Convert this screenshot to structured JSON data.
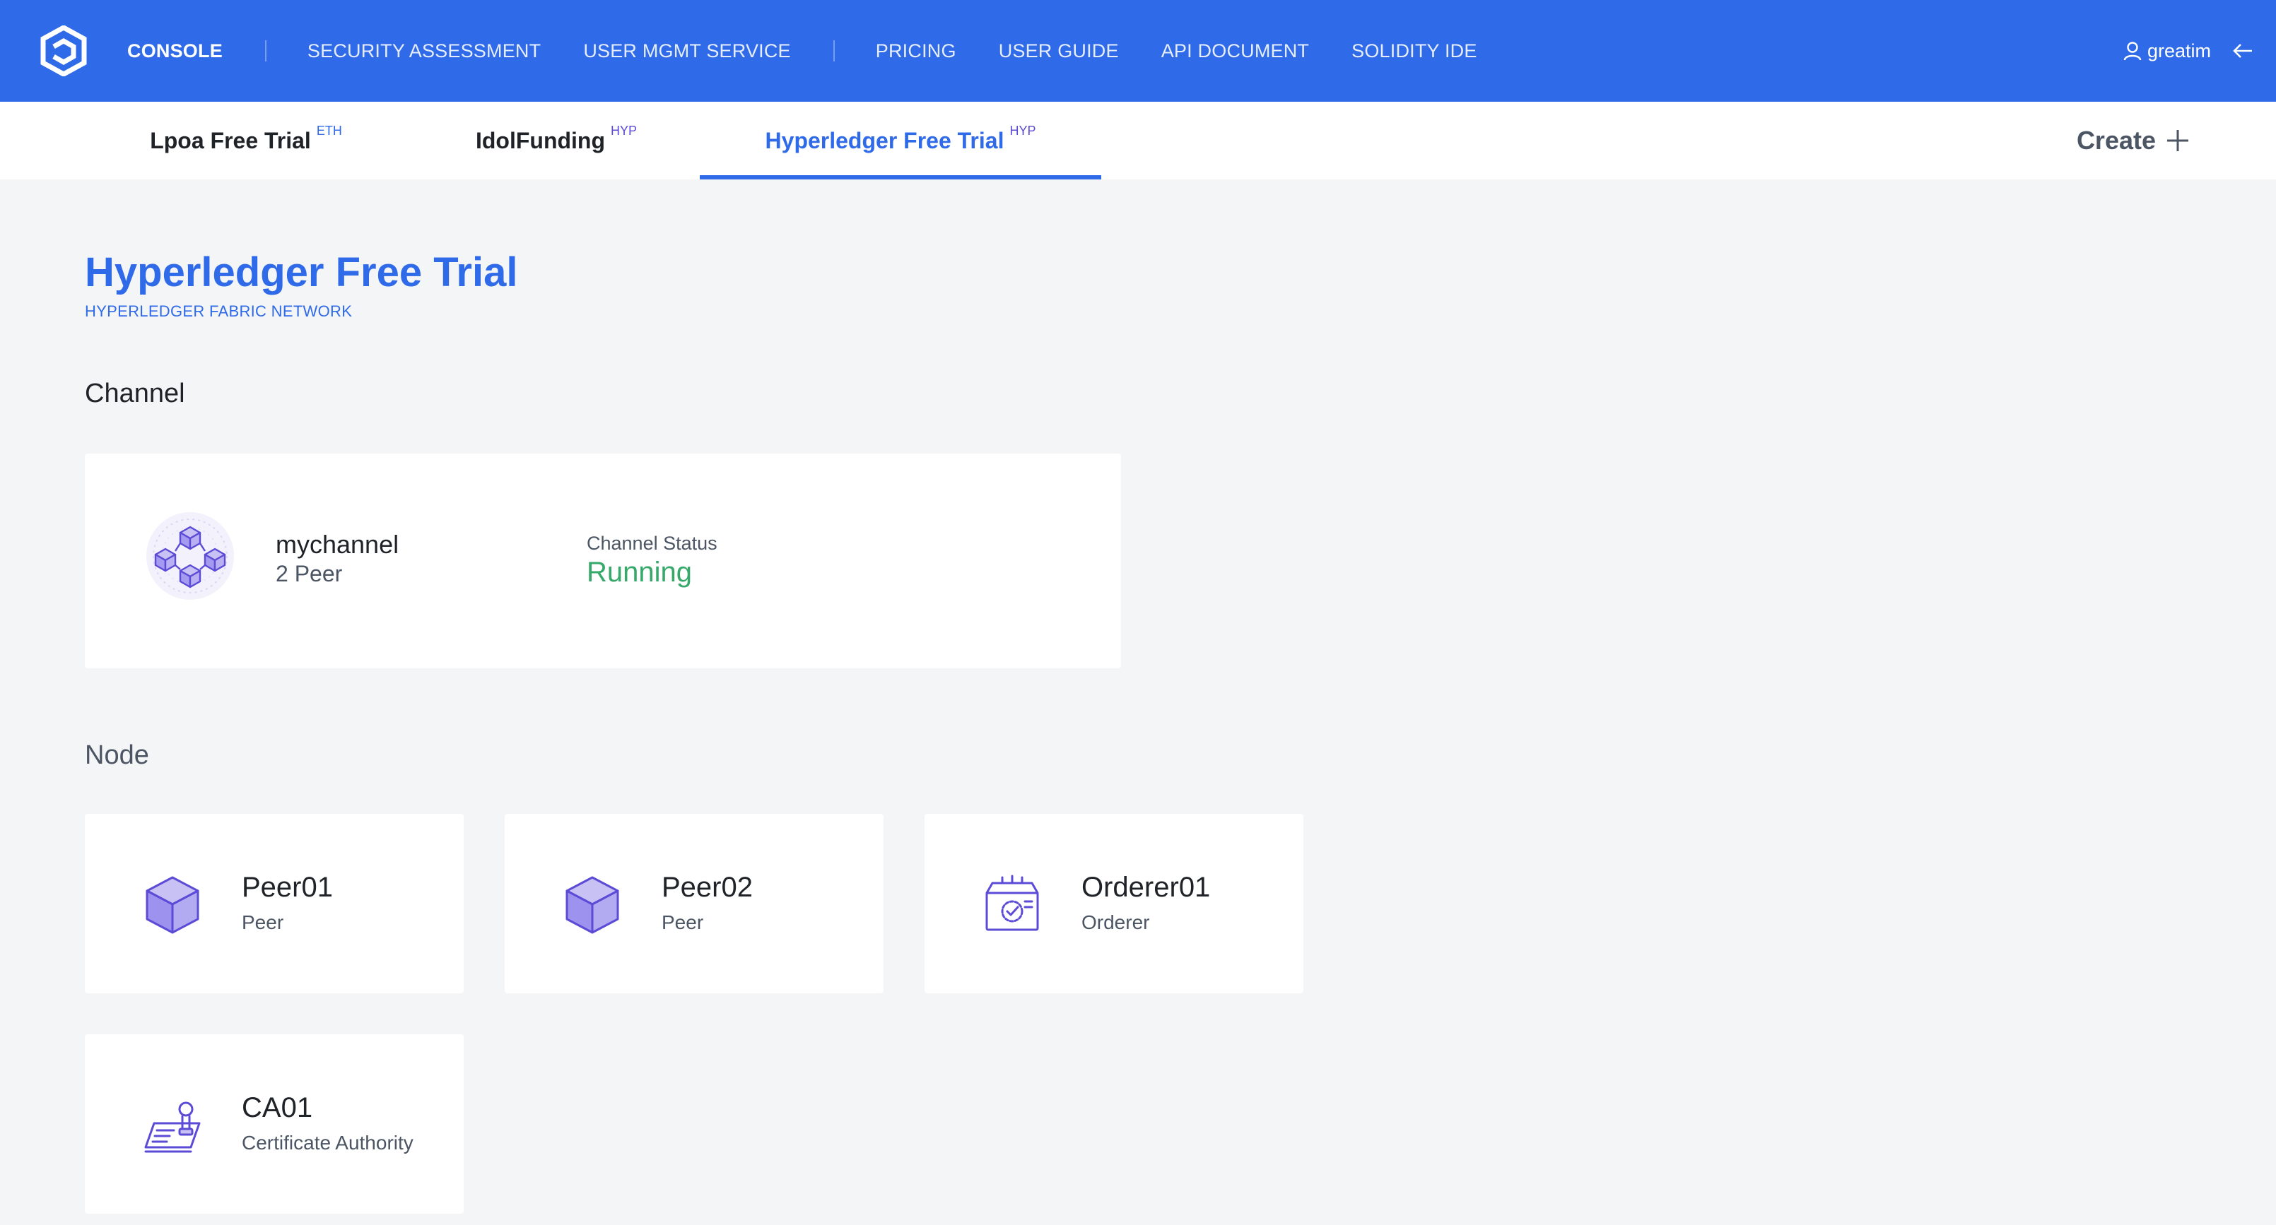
{
  "nav": {
    "items": [
      {
        "label": "CONSOLE",
        "active": true
      },
      {
        "label": "SECURITY ASSESSMENT",
        "active": false
      },
      {
        "label": "USER MGMT SERVICE",
        "active": false
      },
      {
        "label": "PRICING",
        "active": false
      },
      {
        "label": "USER GUIDE",
        "active": false
      },
      {
        "label": "API DOCUMENT",
        "active": false
      },
      {
        "label": "SOLIDITY IDE",
        "active": false
      }
    ],
    "user": "greatim"
  },
  "tabs": [
    {
      "label": "Lpoa Free Trial",
      "badge": "ETH",
      "active": false
    },
    {
      "label": "IdolFunding",
      "badge": "HYP",
      "active": false
    },
    {
      "label": "Hyperledger Free Trial",
      "badge": "HYP",
      "active": true
    }
  ],
  "create_label": "Create",
  "page": {
    "title": "Hyperledger Free Trial",
    "subtitle": "HYPERLEDGER FABRIC NETWORK"
  },
  "channel_section": {
    "heading": "Channel",
    "channel": {
      "name": "mychannel",
      "peers": "2 Peer",
      "status_label": "Channel Status",
      "status_value": "Running"
    }
  },
  "node_section": {
    "heading": "Node",
    "nodes": [
      {
        "name": "Peer01",
        "type": "Peer",
        "icon": "cube-icon"
      },
      {
        "name": "Peer02",
        "type": "Peer",
        "icon": "cube-icon"
      },
      {
        "name": "Orderer01",
        "type": "Orderer",
        "icon": "orderer-box-icon"
      },
      {
        "name": "CA01",
        "type": "Certificate Authority",
        "icon": "certificate-stamp-icon"
      }
    ]
  },
  "colors": {
    "primary": "#2f6ae8",
    "running": "#36a86a",
    "badge_hyp": "#5b4bd6",
    "icon_purple": "#5b4bd6"
  }
}
